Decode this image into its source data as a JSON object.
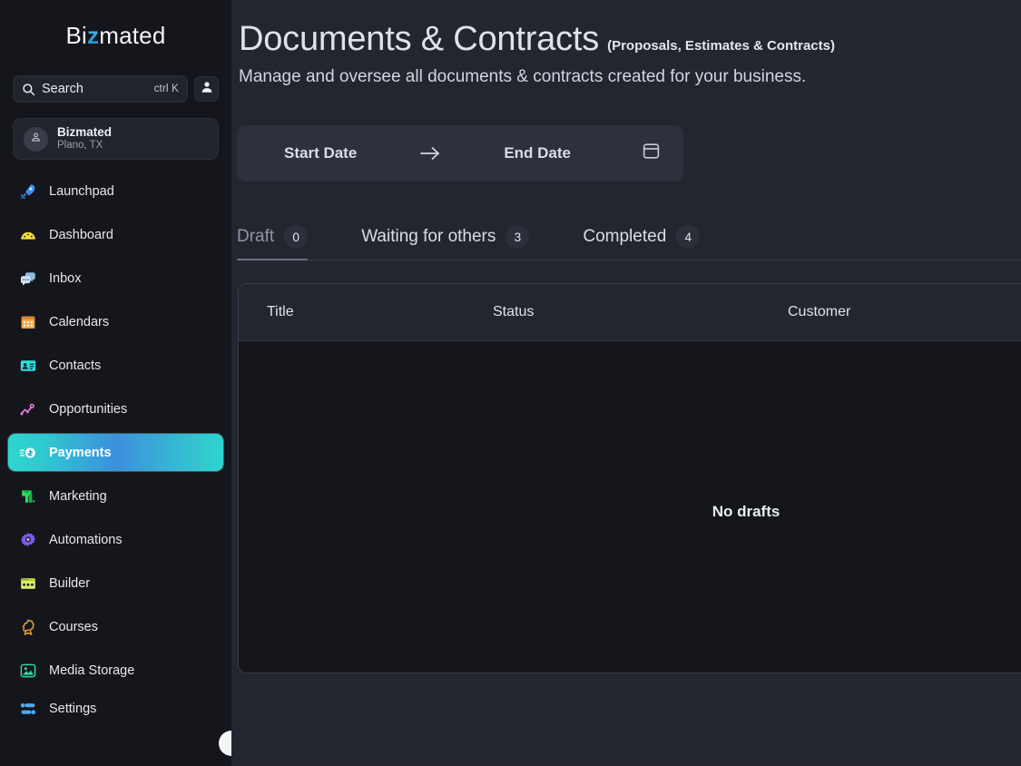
{
  "sidebar": {
    "brand": {
      "prefix": "Bi",
      "accent": "z",
      "suffix": "mated"
    },
    "search": {
      "placeholder": "Search",
      "shortcut": "ctrl K",
      "icon": "search-icon"
    },
    "avatar_icon": "user-avatar-icon",
    "workspace": {
      "name": "Bizmated",
      "location": "Plano, TX",
      "icon": "location-pin-icon"
    },
    "items": [
      {
        "label": "Launchpad",
        "icon": "rocket-icon",
        "color": "#3d8bfd",
        "active": false
      },
      {
        "label": "Dashboard",
        "icon": "gauge-icon",
        "color": "#f5e03a",
        "active": false
      },
      {
        "label": "Inbox",
        "icon": "chat-bubble-icon",
        "color": "#a8c8e8",
        "active": false
      },
      {
        "label": "Calendars",
        "icon": "calendar-icon",
        "color": "#f0a84b",
        "active": false
      },
      {
        "label": "Contacts",
        "icon": "contact-card-icon",
        "color": "#2fe0e0",
        "active": false
      },
      {
        "label": "Opportunities",
        "icon": "funnel-chart-icon",
        "color": "#e87ae0",
        "active": false
      },
      {
        "label": "Payments",
        "icon": "coin-icon",
        "color": "#ffffff",
        "active": true
      },
      {
        "label": "Marketing",
        "icon": "megaphone-icon",
        "color": "#2fd95e",
        "active": false
      },
      {
        "label": "Automations",
        "icon": "gear-icon",
        "color": "#7b5cf0",
        "active": false
      },
      {
        "label": "Builder",
        "icon": "layout-icon",
        "color": "#dff06a",
        "active": false
      },
      {
        "label": "Courses",
        "icon": "award-ribbon-icon",
        "color": "#d9a13a",
        "active": false
      },
      {
        "label": "Media Storage",
        "icon": "image-icon",
        "color": "#2fd9a0",
        "active": false
      },
      {
        "label": "Settings",
        "icon": "sliders-icon",
        "color": "#4fa8f0",
        "active": false
      }
    ],
    "collapse_icon": "chevron-left-icon"
  },
  "header": {
    "title": "Documents & Contracts",
    "title_suffix": "(Proposals, Estimates & Contracts)",
    "description": "Manage and oversee all documents & contracts created for your business."
  },
  "daterange": {
    "start_placeholder": "Start Date",
    "end_placeholder": "End Date",
    "arrow_icon": "arrow-right-icon",
    "calendar_icon": "calendar-icon"
  },
  "tabs": [
    {
      "label": "Draft",
      "count": "0",
      "active": true
    },
    {
      "label": "Waiting for others",
      "count": "3",
      "active": false
    },
    {
      "label": "Completed",
      "count": "4",
      "active": false
    }
  ],
  "table": {
    "columns": [
      "Title",
      "Status",
      "Customer"
    ],
    "rows": [],
    "empty_message": "No drafts"
  },
  "colors": {
    "accent_start": "#2ed6cd",
    "accent_mid": "#3c90dc",
    "page_bg": "#24262f",
    "sidebar_bg": "#15161b",
    "panel_bg": "#2e303c",
    "table_bg": "#14151a",
    "border": "#3a3d4a"
  }
}
